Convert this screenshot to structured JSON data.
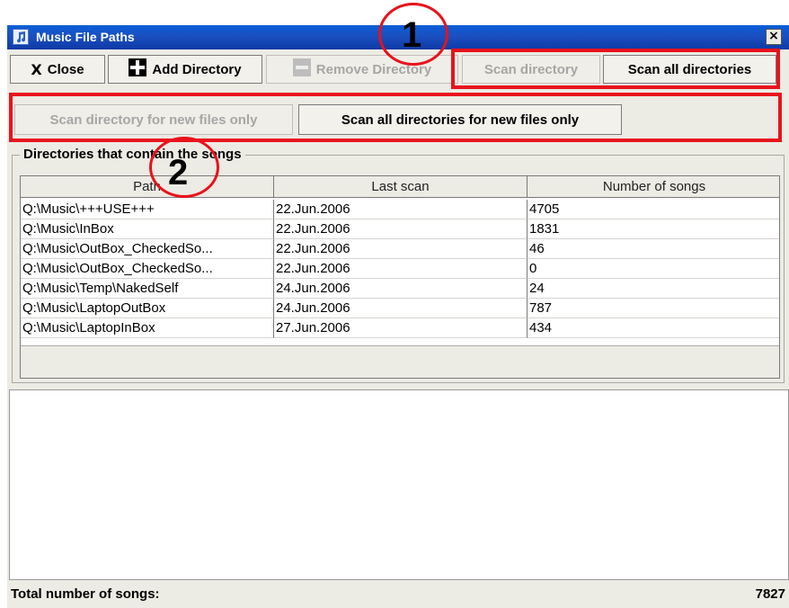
{
  "window": {
    "title": "Music File Paths",
    "close_glyph": "×"
  },
  "toolbar1": {
    "close_label": "Close",
    "close_icon_glyph": "X",
    "add_directory_label": "Add Directory",
    "remove_directory_label": "Remove Directory",
    "scan_directory_label": "Scan directory",
    "scan_all_label": "Scan all directories"
  },
  "toolbar2": {
    "scan_new_label": "Scan directory for new files only",
    "scan_all_new_label": "Scan all directories for new files only"
  },
  "annotations": {
    "one": "1",
    "two": "2",
    "color": "#e8121c"
  },
  "group": {
    "title": "Directories that contain the songs"
  },
  "table": {
    "columns": [
      "Path",
      "Last scan",
      "Number of songs"
    ],
    "rows": [
      [
        "Q:\\Music\\+++USE+++",
        "22.Jun.2006",
        "4705"
      ],
      [
        "Q:\\Music\\InBox",
        "22.Jun.2006",
        "1831"
      ],
      [
        "Q:\\Music\\OutBox_CheckedSo...",
        "22.Jun.2006",
        "46"
      ],
      [
        "Q:\\Music\\OutBox_CheckedSo...",
        "22.Jun.2006",
        "0"
      ],
      [
        "Q:\\Music\\Temp\\NakedSelf",
        "24.Jun.2006",
        "24"
      ],
      [
        "Q:\\Music\\LaptopOutBox",
        "24.Jun.2006",
        "787"
      ],
      [
        "Q:\\Music\\LaptopInBox",
        "27.Jun.2006",
        "434"
      ]
    ]
  },
  "footer": {
    "label": "Total number of songs:",
    "value": "7827"
  },
  "icons": {
    "app": "music-note-icon",
    "close": "x-icon",
    "add": "plus-icon",
    "remove": "minus-icon"
  }
}
